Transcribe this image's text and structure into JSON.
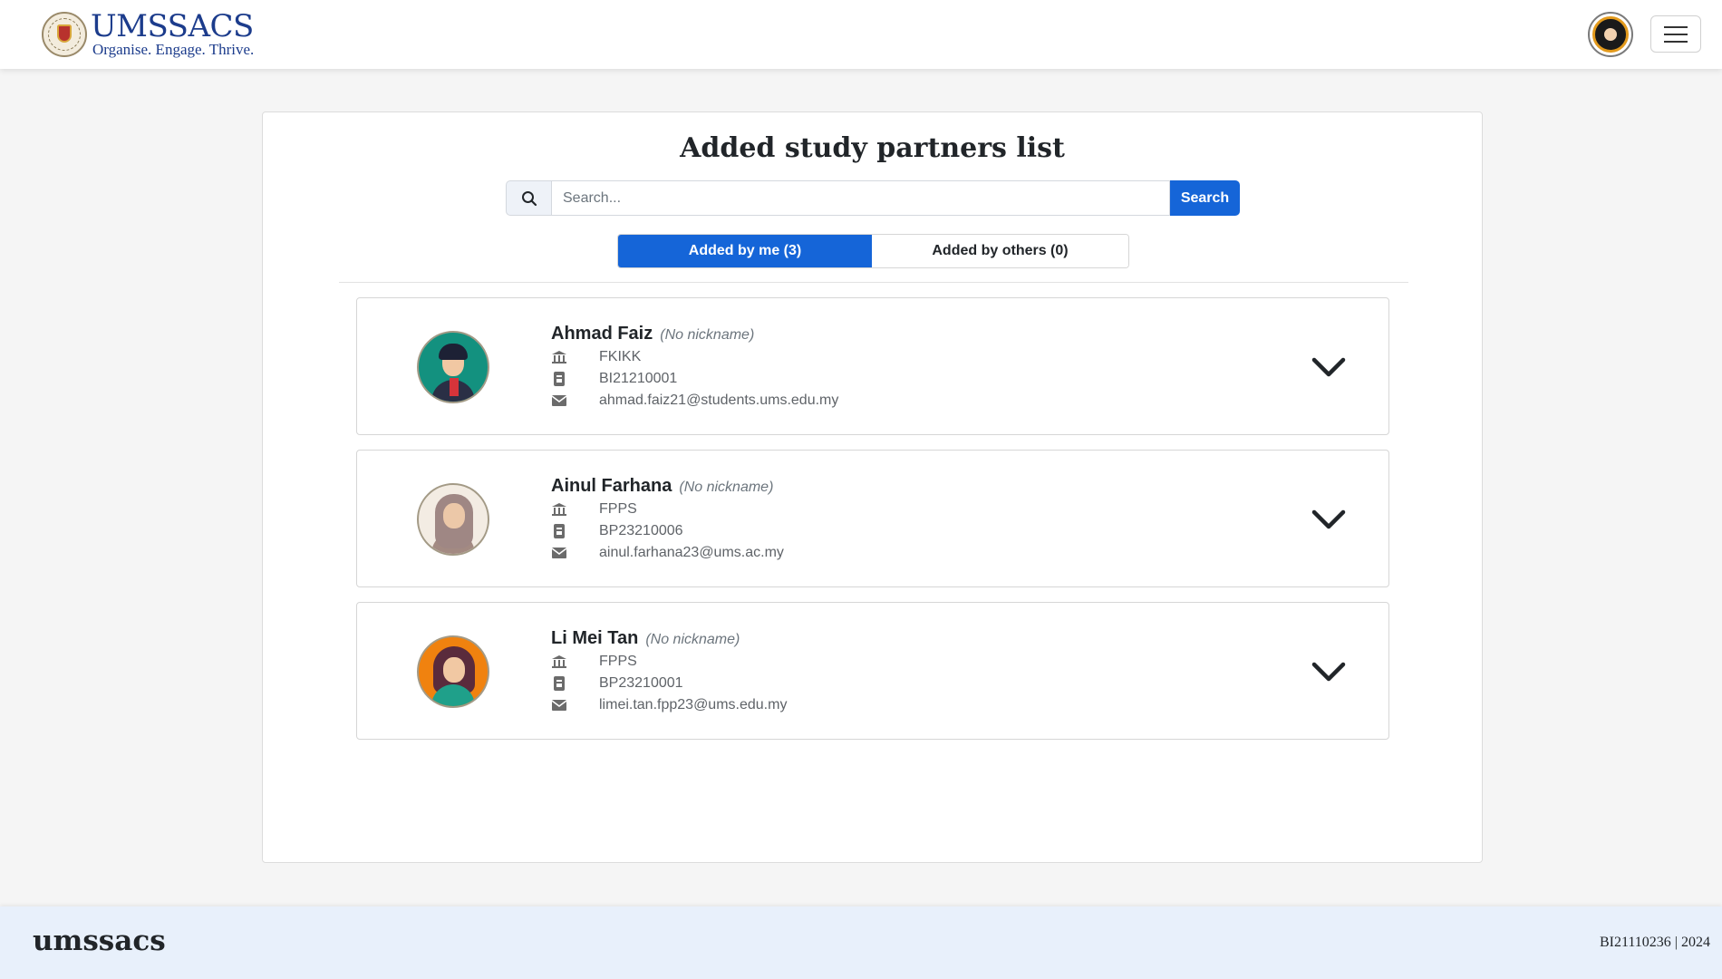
{
  "header": {
    "brand_name": "UMSSACS",
    "brand_tagline": "Organise. Engage. Thrive."
  },
  "main": {
    "title": "Added study partners list",
    "search": {
      "placeholder": "Search...",
      "value": "",
      "button_label": "Search"
    },
    "tabs": [
      {
        "label": "Added by me (3)",
        "active": true
      },
      {
        "label": "Added by others (0)",
        "active": false
      }
    ],
    "partners": [
      {
        "name": "Ahmad Faiz",
        "nickname": "(No nickname)",
        "faculty": "FKIKK",
        "matric": "BI21210001",
        "email": "ahmad.faiz21@students.ums.edu.my",
        "avatar": "male-avatar-teal"
      },
      {
        "name": "Ainul Farhana",
        "nickname": "(No nickname)",
        "faculty": "FPPS",
        "matric": "BP23210006",
        "email": "ainul.farhana23@ums.ac.my",
        "avatar": "hijab-avatar-beige"
      },
      {
        "name": "Li Mei Tan",
        "nickname": "(No nickname)",
        "faculty": "FPPS",
        "matric": "BP23210001",
        "email": "limei.tan.fpp23@ums.edu.my",
        "avatar": "female-avatar-orange"
      }
    ]
  },
  "footer": {
    "brand": "umssacs",
    "info": "BI21110236 | 2024"
  },
  "colors": {
    "primary": "#1565d8",
    "brand_blue": "#1c3c8c",
    "footer_bg": "#e8f0fb",
    "page_bg": "#f5f5f5"
  }
}
